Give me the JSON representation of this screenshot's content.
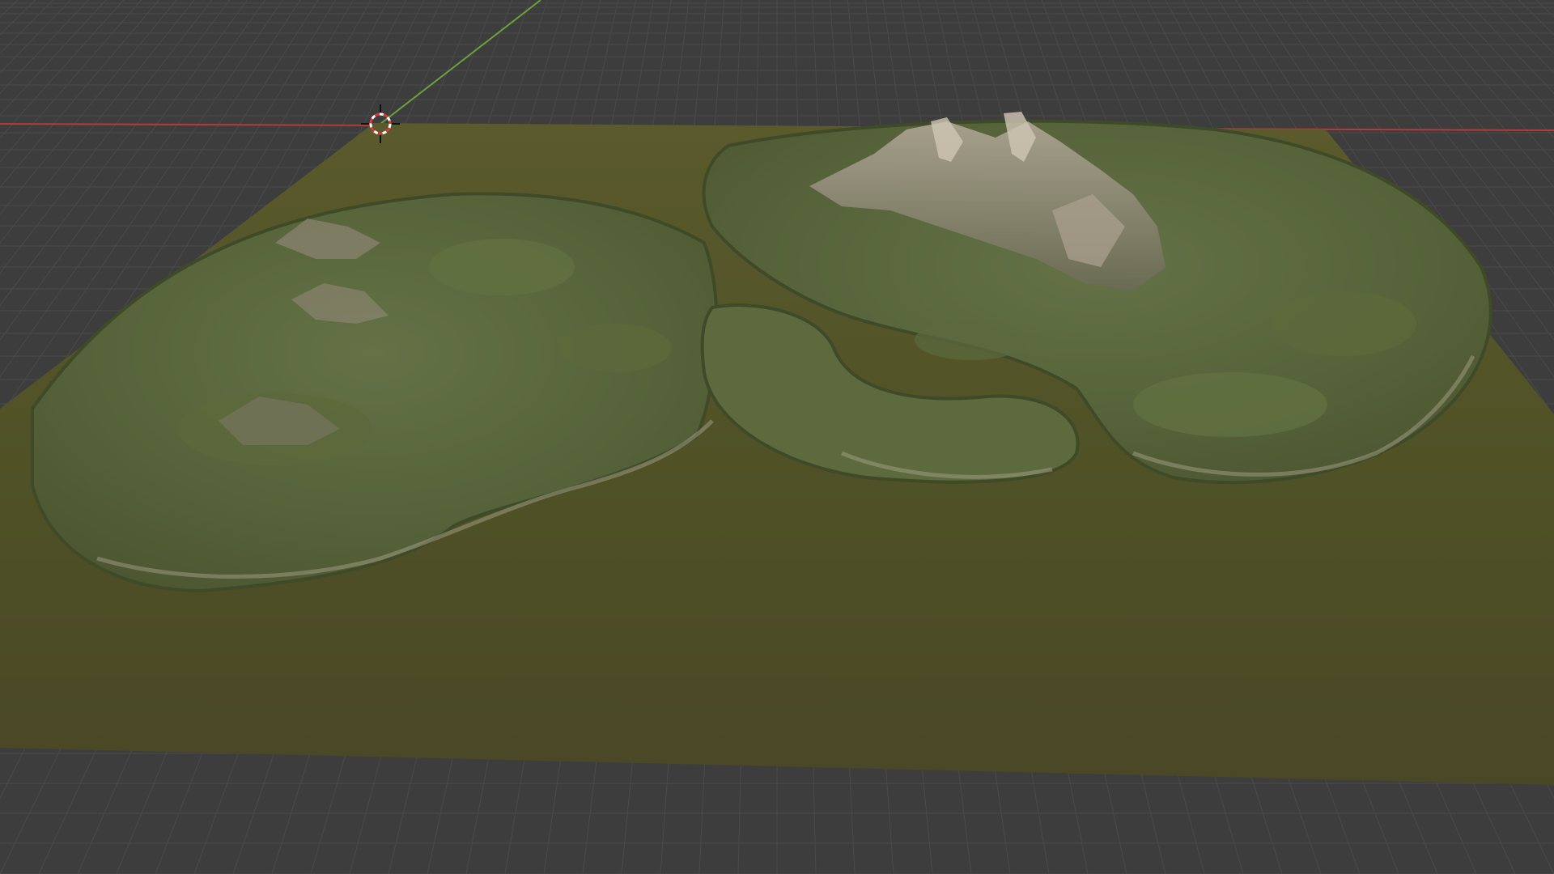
{
  "viewport": {
    "kind": "3d-viewport",
    "background": "#3d3d3d",
    "grid_line_color": "#4a4a4a",
    "x_axis_color": "#b33b3b",
    "y_axis_color": "#6aa23a"
  },
  "scene": {
    "object": "terrain-mesh",
    "terrain_base_color": "#4f5126",
    "terrain_highlight_color": "#6e6a3a",
    "rock_color": "#9a9386"
  },
  "cursor": {
    "icon": "3d-cursor-icon",
    "ring_color": "#ffffff",
    "ring_accent_color": "#d23b3b"
  }
}
